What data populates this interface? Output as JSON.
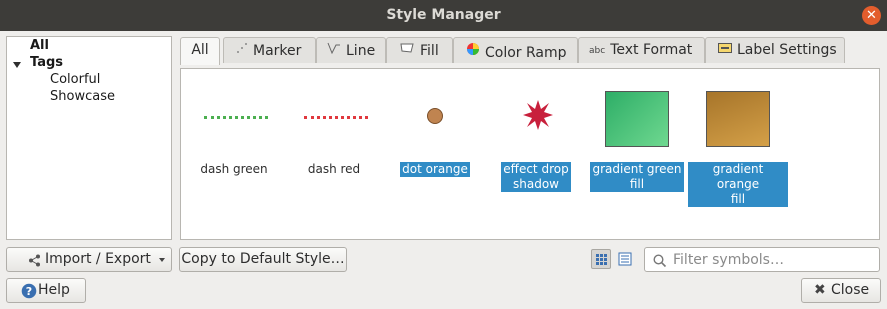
{
  "window": {
    "title": "Style Manager"
  },
  "tree": {
    "all": "All",
    "tags": "Tags",
    "children": [
      "Colorful",
      "Showcase"
    ]
  },
  "tabs": [
    {
      "label": "All",
      "icon": "none"
    },
    {
      "label": "Marker",
      "icon": "marker-icon"
    },
    {
      "label": "Line",
      "icon": "line-icon"
    },
    {
      "label": "Fill",
      "icon": "fill-icon"
    },
    {
      "label": "Color Ramp",
      "icon": "color-ramp-icon"
    },
    {
      "label": "Text Format",
      "icon": "text-format-icon"
    },
    {
      "label": "Label Settings",
      "icon": "label-settings-icon"
    }
  ],
  "symbols": [
    {
      "name": "dash green",
      "selected": false,
      "kind": "dash",
      "color": "#4caf50"
    },
    {
      "name": "dash red",
      "selected": false,
      "kind": "dash",
      "color": "#e0383e"
    },
    {
      "name": "dot orange",
      "selected": true,
      "kind": "dot",
      "color": "#c08450"
    },
    {
      "name_line1": "effect drop",
      "name_line2": "shadow",
      "selected": true,
      "kind": "star",
      "color": "#c8203c"
    },
    {
      "name_line1": "gradient green",
      "name_line2": "fill",
      "selected": true,
      "kind": "gradient",
      "color_a": "#2eae67",
      "color_b": "#6fd890"
    },
    {
      "name_line1": "gradient orange",
      "name_line2": "fill",
      "selected": true,
      "kind": "gradient",
      "color_a": "#a7752a",
      "color_b": "#d4a048"
    }
  ],
  "buttons": {
    "import_export": "Import / Export",
    "copy_default": "Copy to Default Style…",
    "help": "Help",
    "close": "Close"
  },
  "search": {
    "placeholder": "Filter symbols…"
  },
  "colors": {
    "selection": "#308cc6",
    "titlebar": "#3d3c39",
    "close_button": "#e35d2d"
  }
}
